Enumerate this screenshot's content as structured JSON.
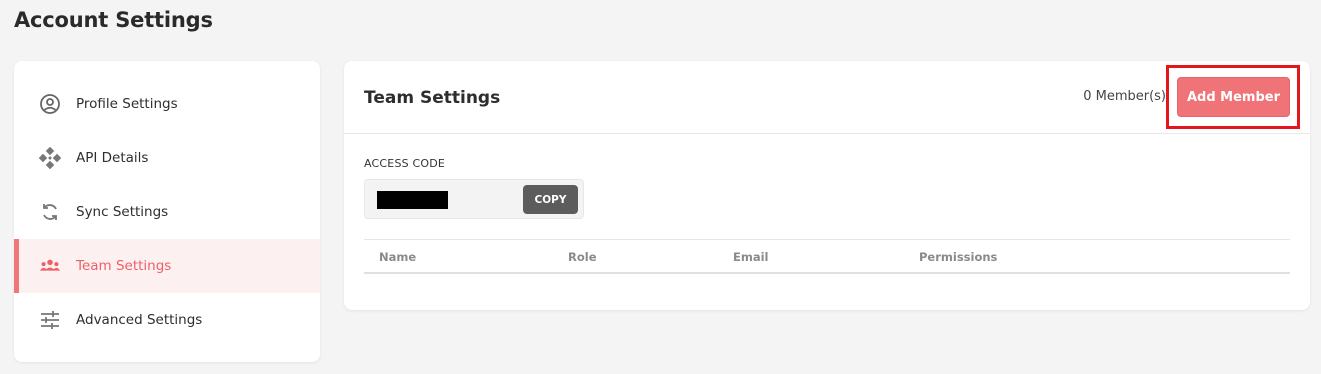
{
  "page": {
    "title": "Account Settings"
  },
  "sidebar": {
    "items": [
      {
        "label": "Profile Settings",
        "icon": "user-circle-icon",
        "active": false
      },
      {
        "label": "API Details",
        "icon": "api-icon",
        "active": false
      },
      {
        "label": "Sync Settings",
        "icon": "sync-icon",
        "active": false
      },
      {
        "label": "Team Settings",
        "icon": "team-icon",
        "active": true
      },
      {
        "label": "Advanced Settings",
        "icon": "sliders-icon",
        "active": false
      }
    ]
  },
  "team": {
    "title": "Team Settings",
    "member_count": "0 Member(s)",
    "add_button": "Add Member",
    "access_code_label": "ACCESS CODE",
    "access_code_value": "",
    "copy_button": "COPY",
    "columns": [
      "Name",
      "Role",
      "Email",
      "Permissions"
    ]
  },
  "colors": {
    "accent": "#f07378",
    "active_text": "#ee5f66",
    "active_bg": "#fdf0f0",
    "highlight": "#e3161b"
  }
}
